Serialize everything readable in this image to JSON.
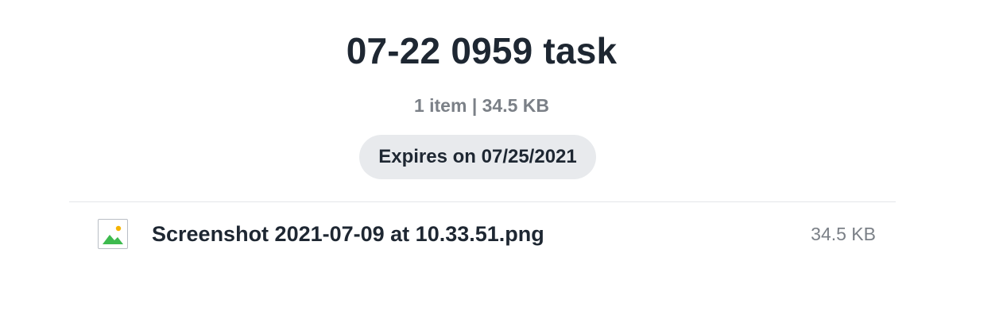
{
  "transfer": {
    "title": "07-22 0959 task",
    "summary": "1 item | 34.5 KB",
    "expires_label": "Expires on 07/25/2021"
  },
  "files": [
    {
      "name": "Screenshot 2021-07-09 at 10.33.51.png",
      "size": "34.5 KB",
      "icon": "image-file-icon"
    }
  ],
  "colors": {
    "title": "#1e2732",
    "muted": "#7b8087",
    "badge_bg": "#e8eaed",
    "divider": "#e4e6e9",
    "icon_sun": "#f5b300",
    "icon_mountain": "#3dba4e"
  }
}
